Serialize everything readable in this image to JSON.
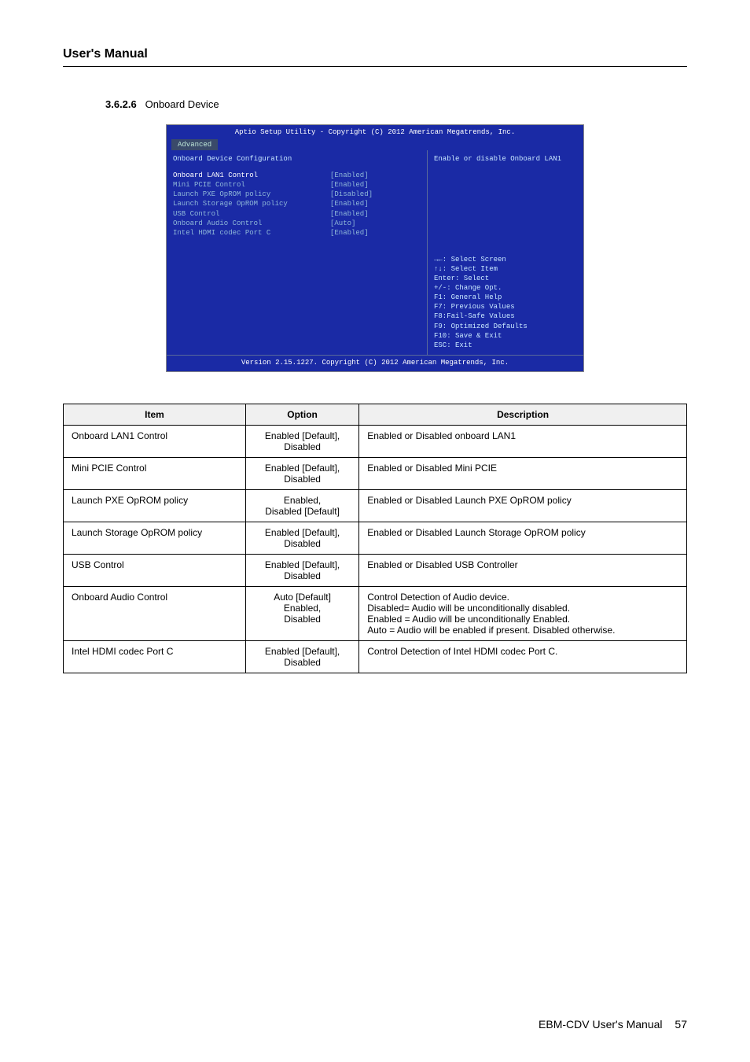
{
  "header": {
    "title": "User's Manual"
  },
  "section": {
    "number": "3.6.2.6",
    "title": "Onboard Device"
  },
  "bios": {
    "utility_title": "Aptio Setup Utility - Copyright (C) 2012 American Megatrends, Inc.",
    "tab": "Advanced",
    "panel_title": "Onboard Device Configuration",
    "help_text": "Enable or disable Onboard LAN1",
    "rows": [
      {
        "label": "Onboard LAN1 Control",
        "value": "[Enabled]",
        "selected": true
      },
      {
        "label": "Mini PCIE Control",
        "value": "[Enabled]",
        "selected": false
      },
      {
        "label": "Launch PXE OpROM policy",
        "value": "[Disabled]",
        "selected": false
      },
      {
        "label": "Launch Storage OpROM policy",
        "value": "[Enabled]",
        "selected": false
      },
      {
        "label": "USB Control",
        "value": "[Enabled]",
        "selected": false
      },
      {
        "label": "Onboard Audio Control",
        "value": "[Auto]",
        "selected": false
      },
      {
        "label": "Intel HDMI codec Port C",
        "value": "[Enabled]",
        "selected": false
      }
    ],
    "nav": [
      "→←: Select Screen",
      "↑↓: Select Item",
      "Enter: Select",
      "+/-: Change Opt.",
      "F1: General Help",
      "F7: Previous Values",
      "F8:Fail-Safe Values",
      "F9: Optimized Defaults",
      "F10: Save & Exit",
      "ESC: Exit"
    ],
    "footer": "Version 2.15.1227. Copyright (C) 2012 American Megatrends, Inc."
  },
  "table": {
    "headers": [
      "Item",
      "Option",
      "Description"
    ],
    "rows": [
      {
        "item": "Onboard LAN1 Control",
        "option": "Enabled [Default],\nDisabled",
        "desc": "Enabled or Disabled onboard LAN1"
      },
      {
        "item": "Mini PCIE Control",
        "option": "Enabled [Default],\nDisabled",
        "desc": "Enabled or Disabled Mini PCIE"
      },
      {
        "item": "Launch PXE OpROM policy",
        "option": "Enabled,\nDisabled [Default]",
        "desc": "Enabled or Disabled Launch PXE OpROM policy"
      },
      {
        "item": "Launch Storage OpROM policy",
        "option": "Enabled [Default],\nDisabled",
        "desc": "Enabled or Disabled Launch Storage OpROM policy"
      },
      {
        "item": "USB Control",
        "option": "Enabled [Default],\nDisabled",
        "desc": "Enabled or Disabled USB Controller"
      },
      {
        "item": "Onboard Audio Control",
        "option": "Auto [Default]\nEnabled,\nDisabled",
        "desc": "Control Detection of Audio device.\nDisabled= Audio will be unconditionally disabled.\nEnabled = Audio will be unconditionally Enabled.\nAuto = Audio will be enabled if present. Disabled otherwise."
      },
      {
        "item": "Intel HDMI codec Port C",
        "option": "Enabled [Default],\nDisabled",
        "desc": "Control Detection of Intel HDMI codec Port C."
      }
    ]
  },
  "footer": {
    "model": "EBM-CDV",
    "label": "User's Manual",
    "page": "57"
  }
}
